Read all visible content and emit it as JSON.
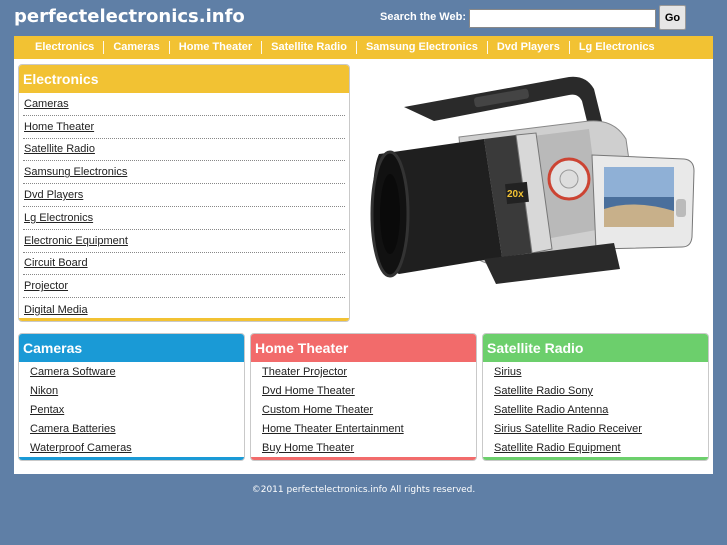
{
  "header": {
    "site_title": "perfectelectronics.info",
    "search_label": "Search the Web:",
    "search_value": "",
    "go_label": "Go"
  },
  "nav": [
    "Electronics",
    "Cameras",
    "Home Theater",
    "Satellite Radio",
    "Samsung Electronics",
    "Dvd Players",
    "Lg Electronics"
  ],
  "main_panel": {
    "title": "Electronics",
    "links": [
      "Cameras",
      "Home Theater",
      "Satellite Radio",
      "Samsung Electronics",
      "Dvd Players",
      "Lg Electronics",
      "Electronic Equipment",
      "Circuit Board",
      "Projector",
      "Digital Media"
    ]
  },
  "hero_image": {
    "zoom_badge": "20x"
  },
  "panels": [
    {
      "title": "Cameras",
      "color": "#1a9ad6",
      "links": [
        "Camera Software",
        "Nikon",
        "Pentax",
        "Camera Batteries",
        "Waterproof Cameras"
      ]
    },
    {
      "title": "Home Theater",
      "color": "#f26b6b",
      "links": [
        "Theater Projector",
        "Dvd Home Theater",
        "Custom Home Theater",
        "Home Theater Entertainment",
        "Buy Home Theater"
      ]
    },
    {
      "title": "Satellite Radio",
      "color": "#6ccf6c",
      "links": [
        "Sirius",
        "Satellite Radio Sony",
        "Satellite Radio Antenna",
        "Sirius Satellite Radio Receiver",
        "Satellite Radio Equipment"
      ]
    }
  ],
  "colors": {
    "accent": "#f2c233",
    "background": "#5f7fa6"
  },
  "footer": {
    "copyright": "©2011 perfectelectronics.info All rights reserved."
  }
}
